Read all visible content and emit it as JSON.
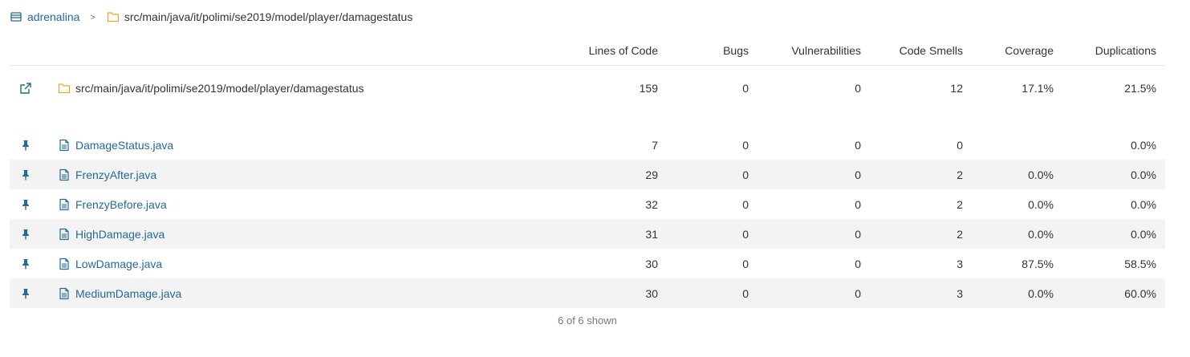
{
  "breadcrumb": {
    "project_label": "adrenalina",
    "separator": ">",
    "current_path": "src/main/java/it/polimi/se2019/model/player/damagestatus"
  },
  "table": {
    "headers": {
      "lines_of_code": "Lines of Code",
      "bugs": "Bugs",
      "vulnerabilities": "Vulnerabilities",
      "code_smells": "Code Smells",
      "coverage": "Coverage",
      "duplications": "Duplications"
    },
    "base": {
      "name": "src/main/java/it/polimi/se2019/model/player/damagestatus",
      "lines_of_code": "159",
      "bugs": "0",
      "vulnerabilities": "0",
      "code_smells": "12",
      "coverage": "17.1%",
      "duplications": "21.5%"
    },
    "rows": [
      {
        "name": "DamageStatus.java",
        "lines_of_code": "7",
        "bugs": "0",
        "vulnerabilities": "0",
        "code_smells": "0",
        "coverage": "",
        "duplications": "0.0%"
      },
      {
        "name": "FrenzyAfter.java",
        "lines_of_code": "29",
        "bugs": "0",
        "vulnerabilities": "0",
        "code_smells": "2",
        "coverage": "0.0%",
        "duplications": "0.0%"
      },
      {
        "name": "FrenzyBefore.java",
        "lines_of_code": "32",
        "bugs": "0",
        "vulnerabilities": "0",
        "code_smells": "2",
        "coverage": "0.0%",
        "duplications": "0.0%"
      },
      {
        "name": "HighDamage.java",
        "lines_of_code": "31",
        "bugs": "0",
        "vulnerabilities": "0",
        "code_smells": "2",
        "coverage": "0.0%",
        "duplications": "0.0%"
      },
      {
        "name": "LowDamage.java",
        "lines_of_code": "30",
        "bugs": "0",
        "vulnerabilities": "0",
        "code_smells": "3",
        "coverage": "87.5%",
        "duplications": "58.5%"
      },
      {
        "name": "MediumDamage.java",
        "lines_of_code": "30",
        "bugs": "0",
        "vulnerabilities": "0",
        "code_smells": "3",
        "coverage": "0.0%",
        "duplications": "60.0%"
      }
    ]
  },
  "footer": {
    "shown_text": "6 of 6 shown"
  },
  "icons": {
    "project": "project-icon",
    "folder": "folder-icon",
    "open_component": "external-link-icon",
    "pin": "pin-icon",
    "file": "file-icon"
  },
  "colors": {
    "link": "#236a97",
    "folder": "#e7a922",
    "alt_row": "#f3f3f3",
    "text": "#333333",
    "muted": "#777777"
  }
}
